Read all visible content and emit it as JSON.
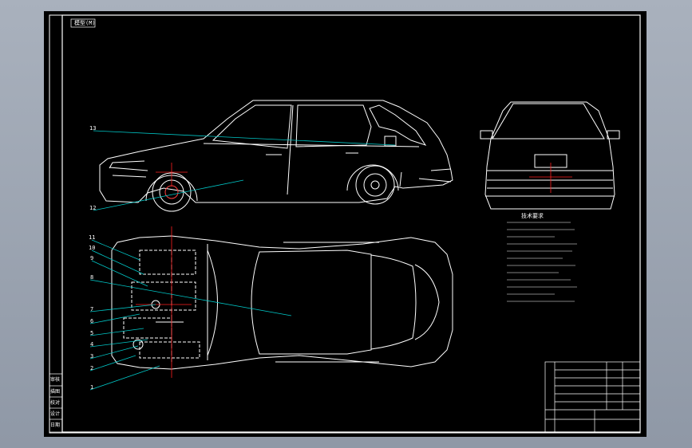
{
  "title_tab": "模型(M)",
  "callouts": [
    "13",
    "12",
    "11",
    "10",
    "9",
    "8",
    "7",
    "6",
    "5",
    "4",
    "3",
    "2",
    "1"
  ],
  "side_stamp_labels": [
    "审核",
    "描图",
    "校对",
    "设计",
    "日期"
  ],
  "tech_requirements_title": "技术要求",
  "colors": {
    "background": "#000000",
    "outline": "#ffffff",
    "leader": "#00c8c8",
    "centerline": "#ff2020",
    "frame_surround": "#9ea6b3"
  },
  "icons": [
    "car-side-view",
    "car-rear-view",
    "car-top-view",
    "wheel-hub",
    "title-block"
  ]
}
